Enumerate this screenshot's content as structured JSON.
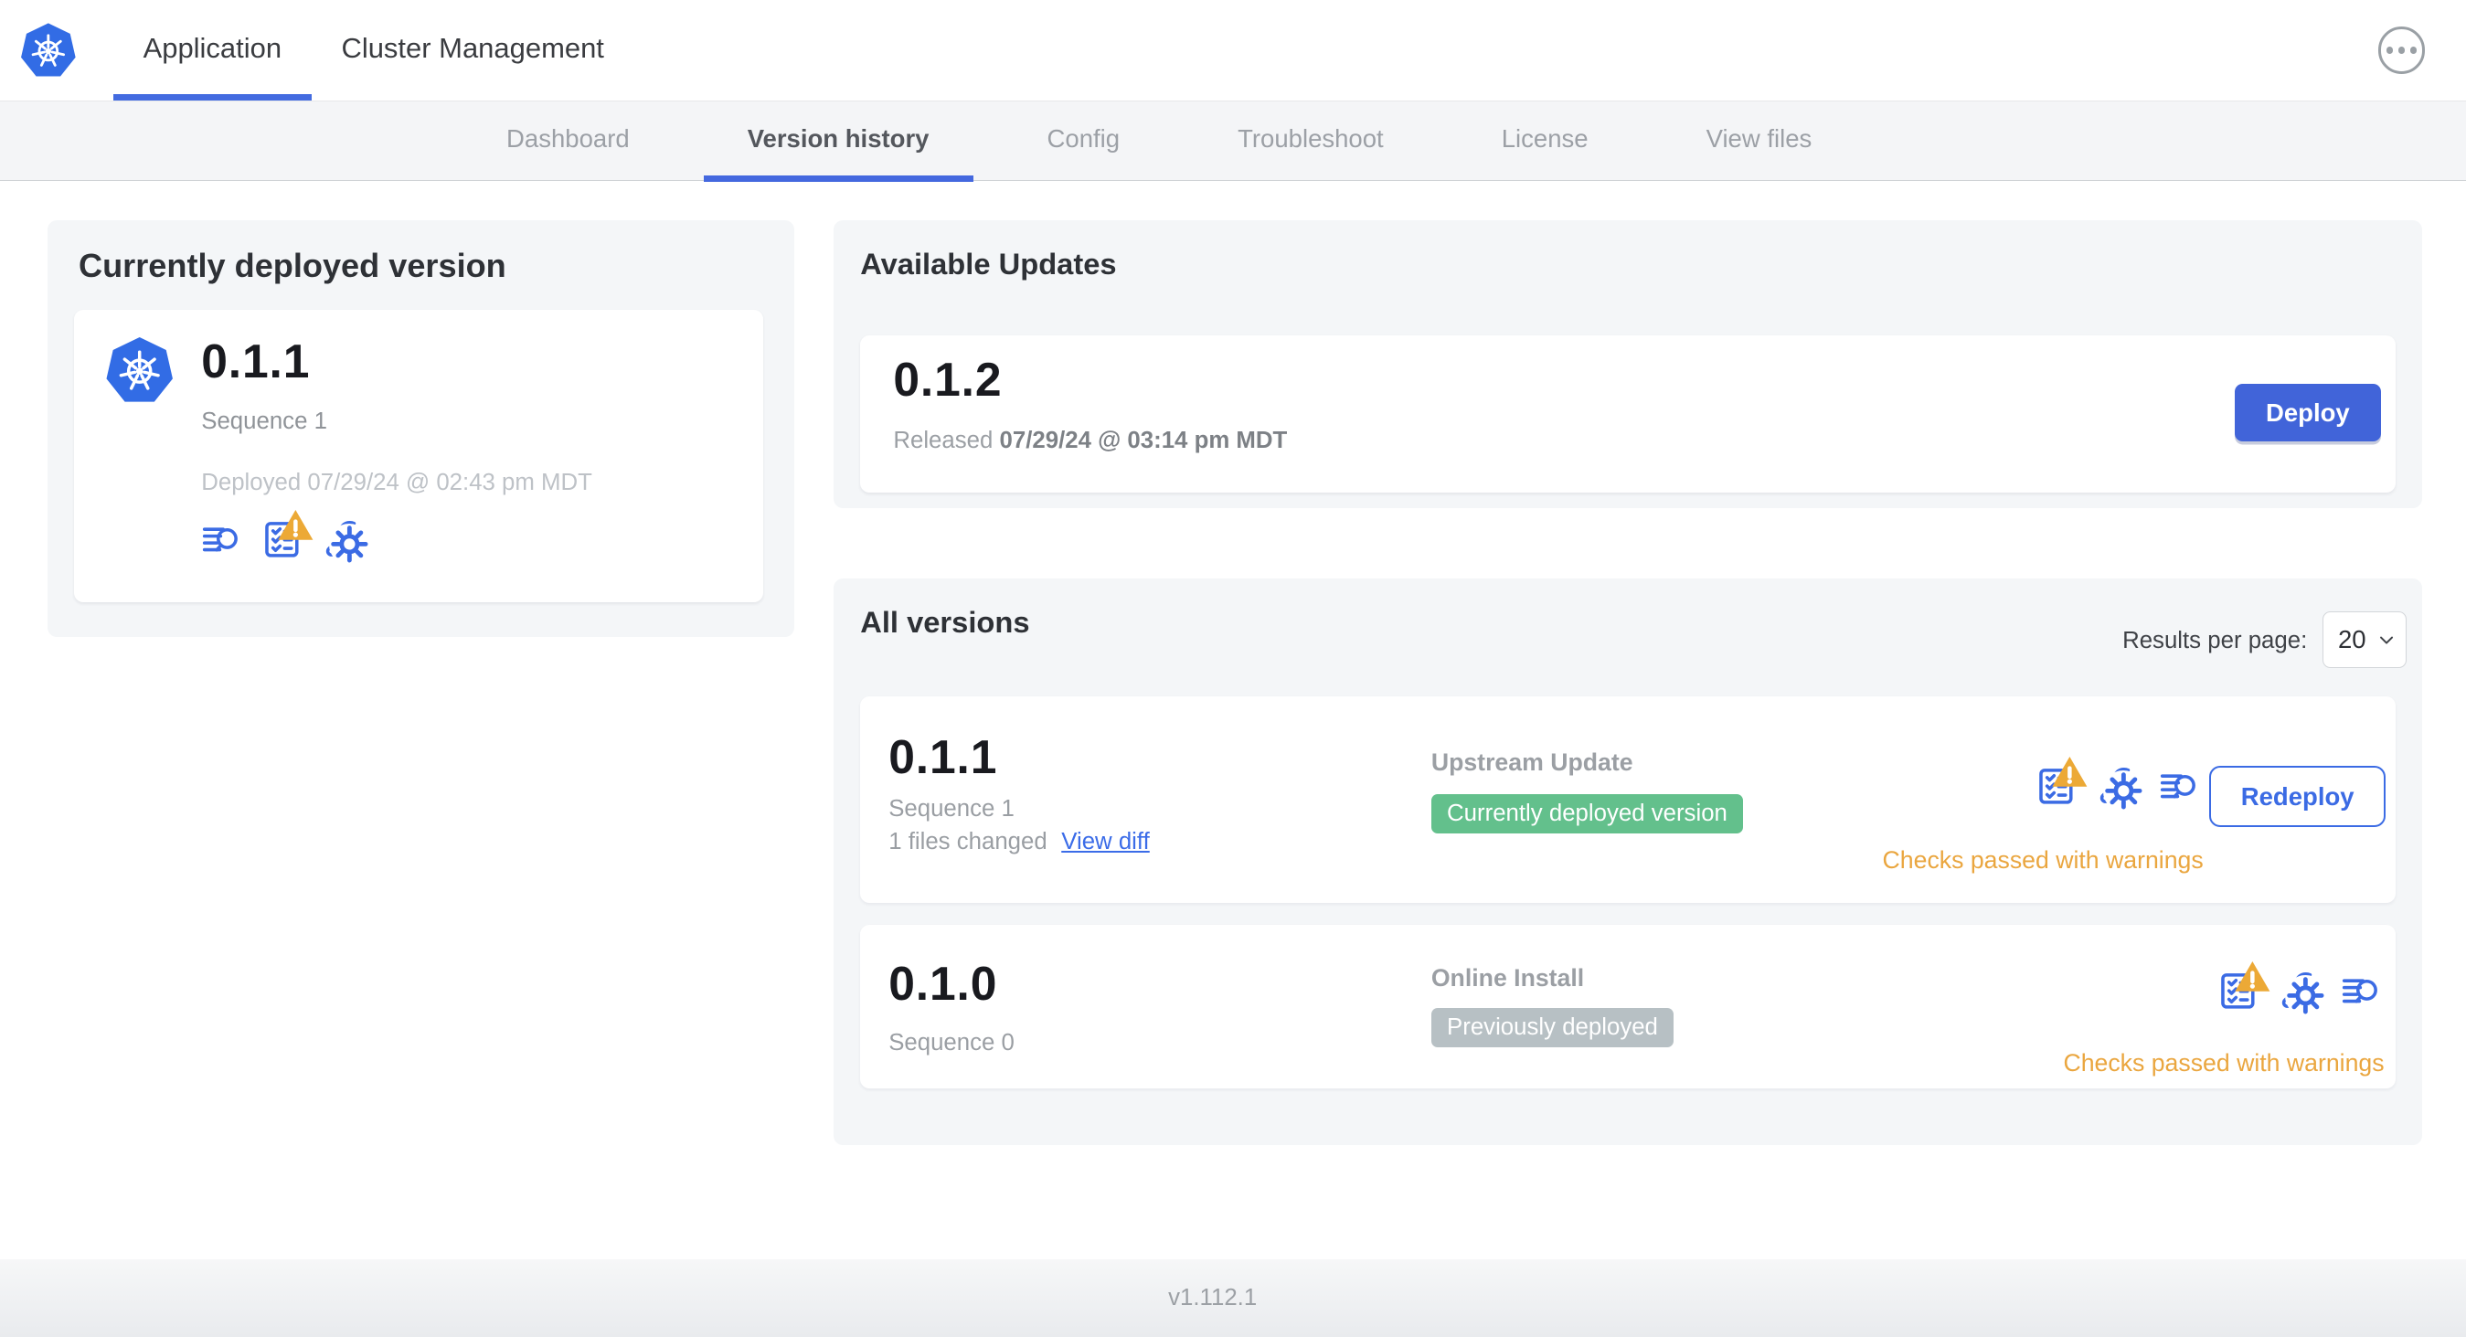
{
  "header": {
    "tabs": [
      {
        "label": "Application",
        "active": true
      },
      {
        "label": "Cluster Management",
        "active": false
      }
    ]
  },
  "subnav": {
    "items": [
      {
        "label": "Dashboard",
        "active": false
      },
      {
        "label": "Version history",
        "active": true
      },
      {
        "label": "Config",
        "active": false
      },
      {
        "label": "Troubleshoot",
        "active": false
      },
      {
        "label": "License",
        "active": false
      },
      {
        "label": "View files",
        "active": false
      }
    ]
  },
  "deployed_card": {
    "title": "Currently deployed version",
    "version": "0.1.1",
    "sequence": "Sequence 1",
    "deployed_at": "Deployed 07/29/24 @ 02:43 pm MDT",
    "icons": [
      "release-notes-icon",
      "preflight-checks-warning-icon",
      "edit-config-icon"
    ]
  },
  "available_updates": {
    "title": "Available Updates",
    "version": "0.1.2",
    "released_label": "Released",
    "released_at": "07/29/24 @ 03:14 pm MDT",
    "deploy_button": "Deploy"
  },
  "all_versions": {
    "title": "All versions",
    "results_per_page_label": "Results per page:",
    "results_per_page_value": "20",
    "rows": [
      {
        "version": "0.1.1",
        "sequence": "Sequence 1",
        "files_changed": "1 files changed",
        "view_diff": "View diff",
        "source": "Upstream Update",
        "badge": "Currently deployed version",
        "status": "Checks passed with warnings",
        "action": "Redeploy",
        "icons": [
          "preflight-checks-warning-icon",
          "edit-config-icon",
          "release-notes-icon"
        ]
      },
      {
        "version": "0.1.0",
        "sequence": "Sequence 0",
        "source": "Online Install",
        "badge": "Previously deployed",
        "status": "Checks passed with warnings",
        "icons": [
          "preflight-checks-warning-icon",
          "edit-config-icon",
          "release-notes-icon"
        ]
      }
    ]
  },
  "footer": {
    "app_version": "v1.112.1"
  },
  "colors": {
    "accent_blue": "#3b6be4",
    "kubernetes_blue": "#326ce5",
    "deploy_button_blue": "#4164d9",
    "badge_green": "#63c08c",
    "badge_gray": "#b7c0c4",
    "warning_orange": "#e9a63f",
    "card_background": "#f4f6f8",
    "subnav_background": "#f4f5f7"
  }
}
